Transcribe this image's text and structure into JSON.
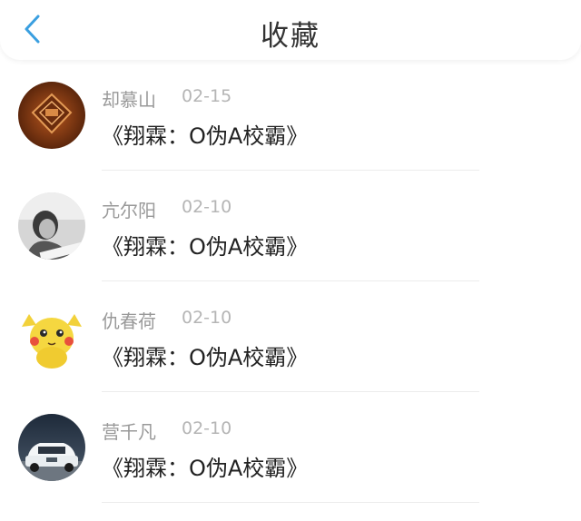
{
  "header": {
    "title": "收藏",
    "back_icon": "chevron-left-icon",
    "accent_color": "#3a9fe0"
  },
  "list": [
    {
      "name": "却慕山",
      "date": "02-15",
      "book": "《翔霖：O伪A校霸》",
      "avatar": "stamp-avatar"
    },
    {
      "name": "亢尔阳",
      "date": "02-10",
      "book": "《翔霖：O伪A校霸》",
      "avatar": "person-photo-avatar"
    },
    {
      "name": "仇春荷",
      "date": "02-10",
      "book": "《翔霖：O伪A校霸》",
      "avatar": "pikachu-avatar"
    },
    {
      "name": "营千凡",
      "date": "02-10",
      "book": "《翔霖：O伪A校霸》",
      "avatar": "car-avatar"
    }
  ]
}
